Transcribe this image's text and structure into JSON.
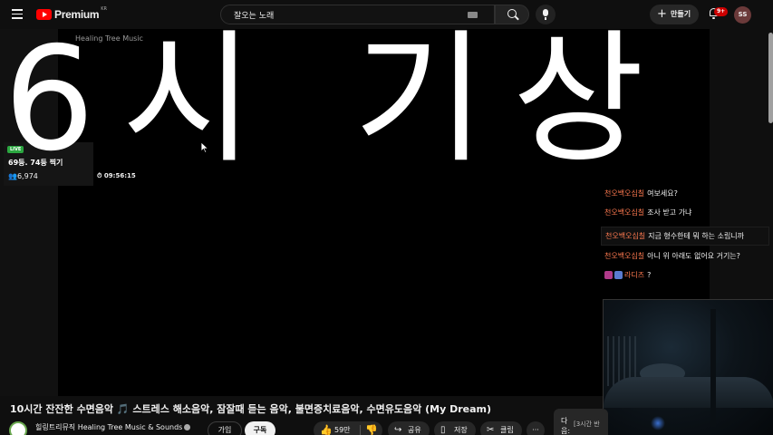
{
  "header": {
    "logo_text": "Premium",
    "logo_region": "KR",
    "search_value": "잘오는 노래",
    "create_label": "만들기",
    "notification_badge": "9+",
    "avatar_initials": "SS"
  },
  "player": {
    "channel_overlay": "Healing Tree Music",
    "caption_text": "6시 기상",
    "live_tag": "LIVE",
    "live_card_title": "69등. 74등 찍기",
    "live_viewers": "6,974",
    "live_elapsed": "09:56:15"
  },
  "chat": {
    "messages": [
      {
        "author": "천오백오십칠",
        "text": "여보세요?"
      },
      {
        "author": "천오백오십칠",
        "text": "조사 받고 가냐"
      },
      {
        "author": "천오백오십칠",
        "text": "지금 형수한테 뭐 하는 소립니까"
      },
      {
        "author": "천오백오십칠",
        "text": "아니 위 아래도 없어요 거기는?"
      },
      {
        "author": "라디즈",
        "text": "?"
      }
    ]
  },
  "video": {
    "title": "10시간 잔잔한 수면음악 🎵 스트레스 해소음악, 잠잘때 듣는 음악, 불면증치료음악, 수면유도음악 (My Dream)",
    "channel_name": "힐링트리뮤직 Healing Tree Music & Sounds",
    "join_label": "가입",
    "subscribe_label": "구독",
    "like_count": "59만",
    "share_label": "공유",
    "save_label": "저장",
    "clip_label": "클립",
    "more_label": "···",
    "next_label": "다음:",
    "next_item": "[3시간 반"
  },
  "colors": {
    "accent_red": "#ff0000",
    "chat_author": "#ff7a50",
    "live_green": "#2ba640"
  }
}
